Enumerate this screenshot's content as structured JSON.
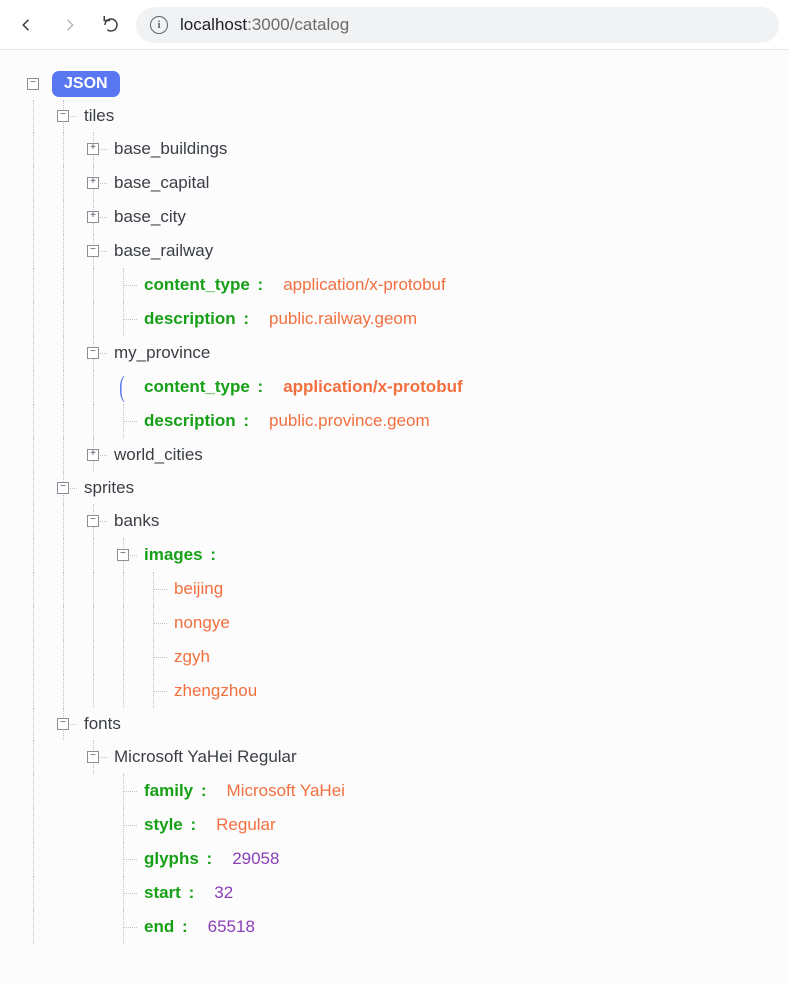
{
  "browser": {
    "url_prefix": "localhost",
    "url_rest": ":3000/catalog"
  },
  "root": {
    "badge": "JSON"
  },
  "tiles": {
    "label": "tiles",
    "base_buildings": "base_buildings",
    "base_capital": "base_capital",
    "base_city": "base_city",
    "base_railway": {
      "label": "base_railway",
      "content_type_key": "content_type",
      "content_type_val": "application/x-protobuf",
      "description_key": "description",
      "description_val": "public.railway.geom"
    },
    "my_province": {
      "label": "my_province",
      "content_type_key": "content_type",
      "content_type_val": "application/x-protobuf",
      "description_key": "description",
      "description_val": "public.province.geom"
    },
    "world_cities": "world_cities"
  },
  "sprites": {
    "label": "sprites",
    "banks": {
      "label": "banks",
      "images_key": "images",
      "items": {
        "0": "beijing",
        "1": "nongye",
        "2": "zgyh",
        "3": "zhengzhou"
      }
    }
  },
  "fonts": {
    "label": "fonts",
    "font0": {
      "label": "Microsoft YaHei Regular",
      "family_key": "family",
      "family_val": "Microsoft YaHei",
      "style_key": "style",
      "style_val": "Regular",
      "glyphs_key": "glyphs",
      "glyphs_val": "29058",
      "start_key": "start",
      "start_val": "32",
      "end_key": "end",
      "end_val": "65518"
    }
  }
}
